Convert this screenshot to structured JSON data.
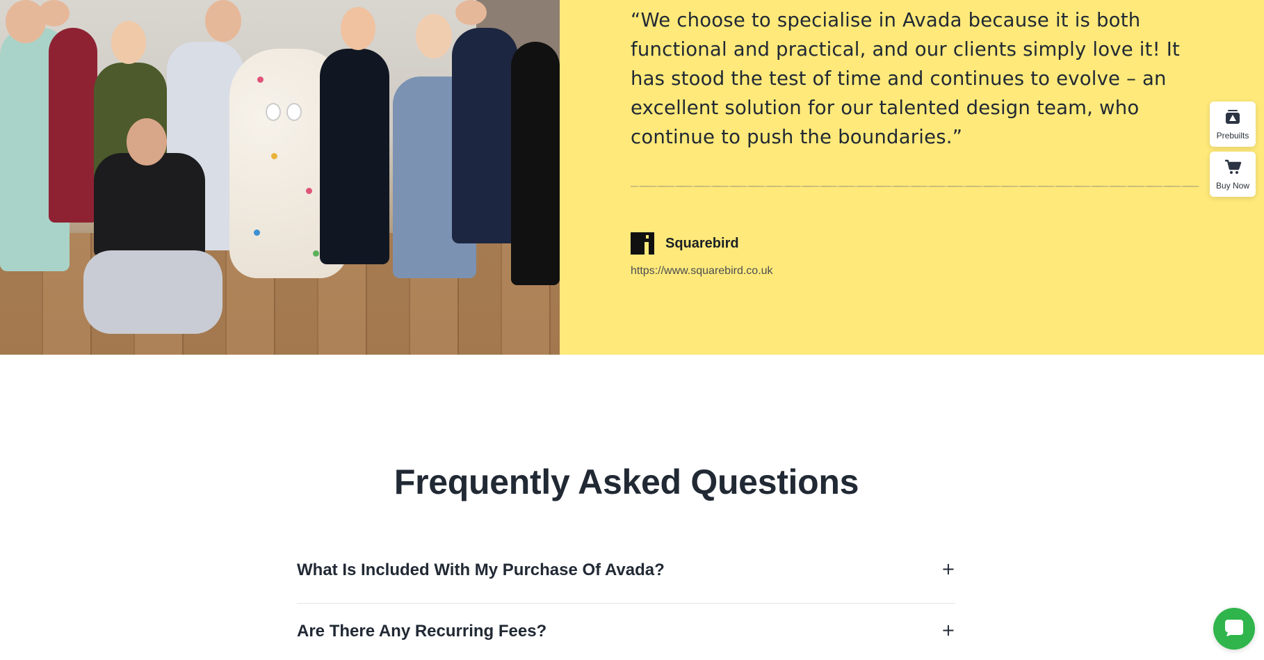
{
  "testimonial": {
    "quote": "“We choose to specialise in Avada because it is both functional and practical, and our clients simply love it! It has stood the test of time and continues to evolve – an excellent solution for our talented design team, who continue to push the boundaries.”",
    "company_name": "Squarebird",
    "company_url": "https://www.squarebird.co.uk",
    "panel_color": "#fee97a"
  },
  "side_buttons": {
    "prebuilts_label": "Prebuilts",
    "buy_now_label": "Buy Now"
  },
  "faq": {
    "title": "Frequently Asked Questions",
    "items": [
      {
        "question": "What Is Included With My Purchase Of Avada?",
        "toggle": "+"
      },
      {
        "question": "Are There Any Recurring Fees?",
        "toggle": "+"
      }
    ]
  },
  "chat": {
    "icon": "chat-bubble-icon",
    "color": "#2fb54b"
  }
}
